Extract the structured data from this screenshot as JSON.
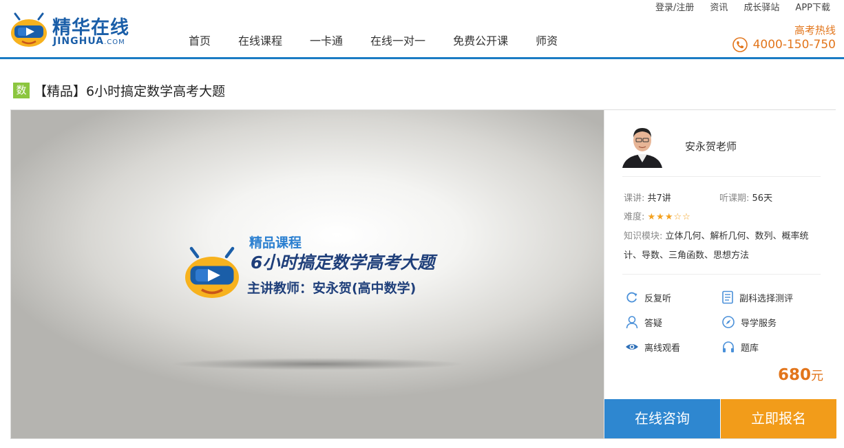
{
  "header": {
    "logo_cn": "精华在线",
    "logo_en": "JINGHUA",
    "logo_suffix": ".COM",
    "nav": [
      "首页",
      "在线课程",
      "一卡通",
      "在线一对一",
      "免费公开课",
      "师资"
    ],
    "toplinks": [
      "登录/注册",
      "资讯",
      "成长驿站",
      "APP下载"
    ],
    "hotline_label": "高考热线",
    "hotline_number": "4000-150-750"
  },
  "course": {
    "subject_badge": "数",
    "title": "【精品】6小时搞定数学高考大题"
  },
  "video": {
    "line1": "精品课程",
    "line2": "6小时搞定数学高考大题",
    "line3": "主讲教师：安永贺(高中数学)"
  },
  "teacher": {
    "name": "安永贺老师"
  },
  "details": {
    "lessons_label": "课讲:",
    "lessons_value": "共7讲",
    "period_label": "听课期:",
    "period_value": "56天",
    "difficulty_label": "难度:",
    "difficulty_stars_filled": "★★★",
    "difficulty_stars_empty": "☆☆",
    "difficulty_rating": 3,
    "difficulty_max": 5,
    "modules_label": "知识模块:",
    "modules_value": "立体几何、解析几何、数列、概率统计、导数、三角函数、思想方法"
  },
  "features": [
    {
      "label": "反复听",
      "icon": "refresh-icon"
    },
    {
      "label": "副科选择测评",
      "icon": "document-icon"
    },
    {
      "label": "答疑",
      "icon": "person-icon"
    },
    {
      "label": "导学服务",
      "icon": "compass-icon"
    },
    {
      "label": "离线观看",
      "icon": "eye-icon"
    },
    {
      "label": "题库",
      "icon": "headphones-icon"
    }
  ],
  "price": {
    "amount": "680",
    "unit": "元"
  },
  "buttons": {
    "consult": "在线咨询",
    "enroll": "立即报名"
  },
  "colors": {
    "brand_blue": "#1a5ea8",
    "accent_orange": "#e2751b",
    "consult_blue": "#2e87d0",
    "enroll_orange": "#f29c1a",
    "badge_green": "#8cc63f"
  }
}
